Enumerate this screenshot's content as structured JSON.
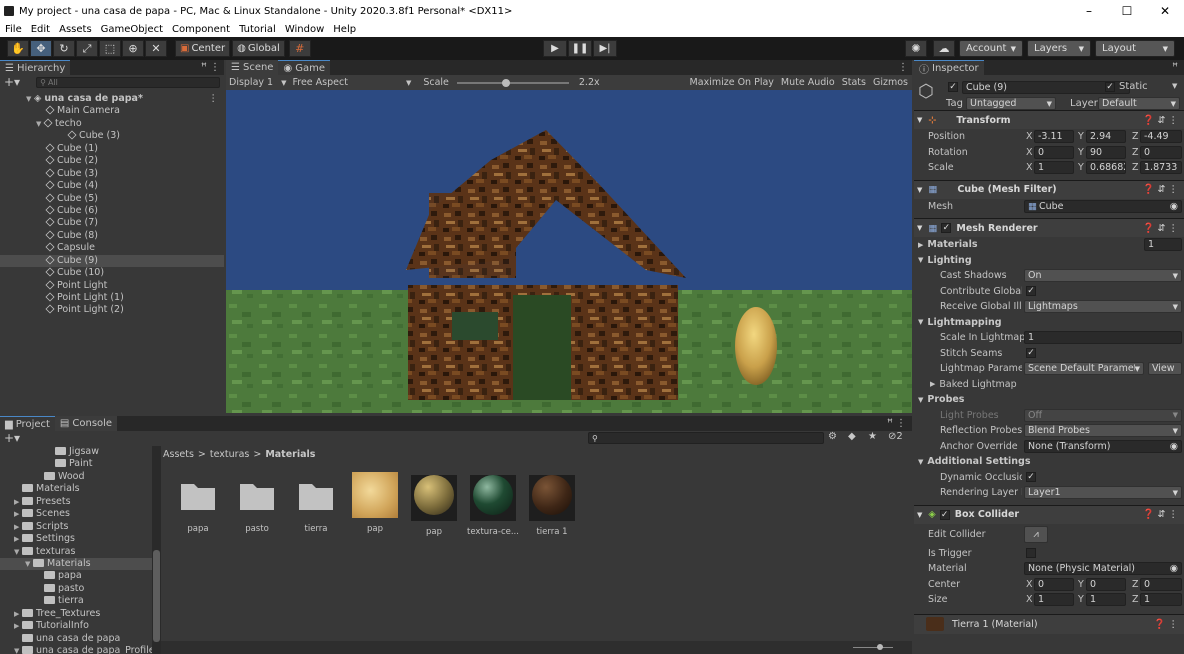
{
  "window": {
    "title": "My project - una casa de papa - PC, Mac & Linux Standalone - Unity 2020.3.8f1 Personal* <DX11>",
    "controls": [
      "–",
      "☐",
      "✕"
    ]
  },
  "menu": [
    "File",
    "Edit",
    "Assets",
    "GameObject",
    "Component",
    "Tutorial",
    "Window",
    "Help"
  ],
  "toolbar": {
    "tools": [
      "hand-icon",
      "move-icon",
      "rotate-icon",
      "scale-icon",
      "rect-icon",
      "transform-icon",
      "custom-tool-icon"
    ],
    "pivot": "Center",
    "space": "Global",
    "account": "Account",
    "layers": "Layers",
    "layout": "Layout"
  },
  "hierarchy": {
    "tab": "Hierarchy",
    "search_placeholder": "All",
    "scene": "una casa de papa*",
    "items": [
      {
        "label": "Main Camera",
        "indent": 2
      },
      {
        "label": "techo",
        "indent": 2,
        "expanded": true
      },
      {
        "label": "Cube (3)",
        "indent": 3
      },
      {
        "label": "Cube (1)",
        "indent": 2
      },
      {
        "label": "Cube (2)",
        "indent": 2
      },
      {
        "label": "Cube (3)",
        "indent": 2
      },
      {
        "label": "Cube (4)",
        "indent": 2
      },
      {
        "label": "Cube (5)",
        "indent": 2
      },
      {
        "label": "Cube (6)",
        "indent": 2
      },
      {
        "label": "Cube (7)",
        "indent": 2
      },
      {
        "label": "Cube (8)",
        "indent": 2
      },
      {
        "label": "Capsule",
        "indent": 2
      },
      {
        "label": "Cube (9)",
        "indent": 2,
        "selected": true
      },
      {
        "label": "Cube (10)",
        "indent": 2
      },
      {
        "label": "Point Light",
        "indent": 2
      },
      {
        "label": "Point Light (1)",
        "indent": 2
      },
      {
        "label": "Point Light (2)",
        "indent": 2
      }
    ]
  },
  "view": {
    "tabs": [
      "Scene",
      "Game"
    ],
    "display": "Display 1",
    "aspect": "Free Aspect",
    "scale_label": "Scale",
    "scale_value": "2.2x",
    "buttons": [
      "Maximize On Play",
      "Mute Audio",
      "Stats",
      "Gizmos"
    ]
  },
  "project": {
    "tabs": [
      "Project",
      "Console"
    ],
    "badge": "2",
    "breadcrumb": [
      "Assets",
      "texturas",
      "Materials"
    ],
    "tree": [
      {
        "label": "Jigsaw",
        "indent": 4
      },
      {
        "label": "Paint",
        "indent": 4
      },
      {
        "label": "Wood",
        "indent": 3
      },
      {
        "label": "Materials",
        "indent": 1
      },
      {
        "label": "Presets",
        "indent": 1,
        "arrow": "▶"
      },
      {
        "label": "Scenes",
        "indent": 1,
        "arrow": "▶"
      },
      {
        "label": "Scripts",
        "indent": 1,
        "arrow": "▶"
      },
      {
        "label": "Settings",
        "indent": 1,
        "arrow": "▶"
      },
      {
        "label": "texturas",
        "indent": 1,
        "arrow": "▼"
      },
      {
        "label": "Materials",
        "indent": 2,
        "arrow": "▼",
        "selected": true
      },
      {
        "label": "papa",
        "indent": 3
      },
      {
        "label": "pasto",
        "indent": 3
      },
      {
        "label": "tierra",
        "indent": 3
      },
      {
        "label": "Tree_Textures",
        "indent": 1,
        "arrow": "▶"
      },
      {
        "label": "TutorialInfo",
        "indent": 1,
        "arrow": "▶"
      },
      {
        "label": "una casa de papa",
        "indent": 1
      },
      {
        "label": "una casa de papa_Profile",
        "indent": 1,
        "arrow": "▼"
      }
    ],
    "assets": [
      {
        "label": "papa",
        "kind": "folder"
      },
      {
        "label": "pasto",
        "kind": "folder"
      },
      {
        "label": "tierra",
        "kind": "folder"
      },
      {
        "label": "pap",
        "kind": "texture"
      },
      {
        "label": "pap",
        "kind": "material-potato"
      },
      {
        "label": "textura-ce...",
        "kind": "material-green"
      },
      {
        "label": "tierra 1",
        "kind": "material-dirt"
      }
    ]
  },
  "inspector": {
    "tab": "Inspector",
    "object_name": "Cube (9)",
    "static_label": "Static",
    "tag_label": "Tag",
    "tag_value": "Untagged",
    "layer_label": "Layer",
    "layer_value": "Default",
    "transform": {
      "title": "Transform",
      "rows": [
        {
          "label": "Position",
          "x": "-3.11",
          "y": "2.94",
          "z": "-4.49"
        },
        {
          "label": "Rotation",
          "x": "0",
          "y": "90",
          "z": "0"
        },
        {
          "label": "Scale",
          "x": "1",
          "y": "0.68682",
          "z": "1.8733"
        }
      ]
    },
    "mesh_filter": {
      "title": "Cube (Mesh Filter)",
      "mesh_label": "Mesh",
      "mesh_value": "Cube"
    },
    "mesh_renderer": {
      "title": "Mesh Renderer",
      "materials_label": "Materials",
      "materials_count": "1",
      "lighting": "Lighting",
      "cast_shadows_label": "Cast Shadows",
      "cast_shadows_value": "On",
      "contribute_gi_label": "Contribute Global I",
      "receive_gi_label": "Receive Global Illu",
      "receive_gi_value": "Lightmaps",
      "lightmapping": "Lightmapping",
      "scale_lightmap_label": "Scale In Lightmap",
      "scale_lightmap_value": "1",
      "stitch_label": "Stitch Seams",
      "lightmap_params_label": "Lightmap Paramet",
      "lightmap_params_value": "Scene Default Paramete",
      "view_button": "View",
      "baked_lightmap": "Baked Lightmap",
      "probes": "Probes",
      "light_probes_label": "Light Probes",
      "light_probes_value": "Off",
      "reflection_probes_label": "Reflection Probes",
      "reflection_probes_value": "Blend Probes",
      "anchor_label": "Anchor Override",
      "anchor_value": "None (Transform)",
      "additional": "Additional Settings",
      "dynamic_occ_label": "Dynamic Occlusio",
      "rendering_layer_label": "Rendering Layer M",
      "rendering_layer_value": "Layer1"
    },
    "box_collider": {
      "title": "Box Collider",
      "edit_label": "Edit Collider",
      "trigger_label": "Is Trigger",
      "material_label": "Material",
      "material_value": "None (Physic Material)",
      "center_label": "Center",
      "center": {
        "x": "0",
        "y": "0",
        "z": "0"
      },
      "size_label": "Size",
      "size": {
        "x": "1",
        "y": "1",
        "z": "1"
      }
    },
    "material_footer": "Tierra 1 (Material)"
  }
}
